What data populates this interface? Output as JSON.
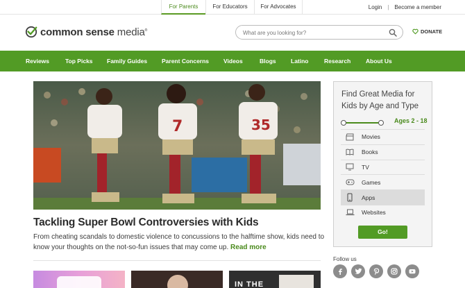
{
  "audience_tabs": [
    {
      "label": "For Parents",
      "active": true
    },
    {
      "label": "For Educators",
      "active": false
    },
    {
      "label": "For Advocates",
      "active": false
    }
  ],
  "account": {
    "login": "Login",
    "separator": "|",
    "become_member": "Become a member"
  },
  "brand": {
    "name_bold": "common sense",
    "name_light": "media",
    "mark": "®",
    "accent": "#529b25"
  },
  "search": {
    "placeholder": "What are you looking for?",
    "value": ""
  },
  "donate": {
    "label": "DONATE"
  },
  "nav": [
    {
      "label": "Reviews"
    },
    {
      "label": "Top Picks"
    },
    {
      "label": "Family Guides"
    },
    {
      "label": "Parent Concerns"
    },
    {
      "label": "Videos"
    },
    {
      "label": "Blogs"
    },
    {
      "label": "Latino"
    },
    {
      "label": "Research"
    },
    {
      "label": "About Us"
    }
  ],
  "hero": {
    "title": "Tackling Super Bowl Controversies with Kids",
    "description": "From cheating scandals to domestic violence to concussions to the halftime show, kids need to know your thoughts on the not-so-fun issues that may come up.",
    "read_more": "Read more"
  },
  "finder": {
    "title": "Find Great Media for Kids by Age and Type",
    "ages_label": "Ages 2 - 18",
    "items": [
      {
        "label": "Movies",
        "icon": "movie-clapper-icon",
        "selected": false
      },
      {
        "label": "Books",
        "icon": "book-icon",
        "selected": false
      },
      {
        "label": "TV",
        "icon": "tv-icon",
        "selected": false
      },
      {
        "label": "Games",
        "icon": "gamepad-icon",
        "selected": false
      },
      {
        "label": "Apps",
        "icon": "phone-icon",
        "selected": true
      },
      {
        "label": "Websites",
        "icon": "laptop-icon",
        "selected": false
      }
    ],
    "go_label": "Go!"
  },
  "follow": {
    "label": "Follow us",
    "networks": [
      "facebook-icon",
      "twitter-icon",
      "pinterest-icon",
      "instagram-icon",
      "youtube-icon"
    ]
  }
}
